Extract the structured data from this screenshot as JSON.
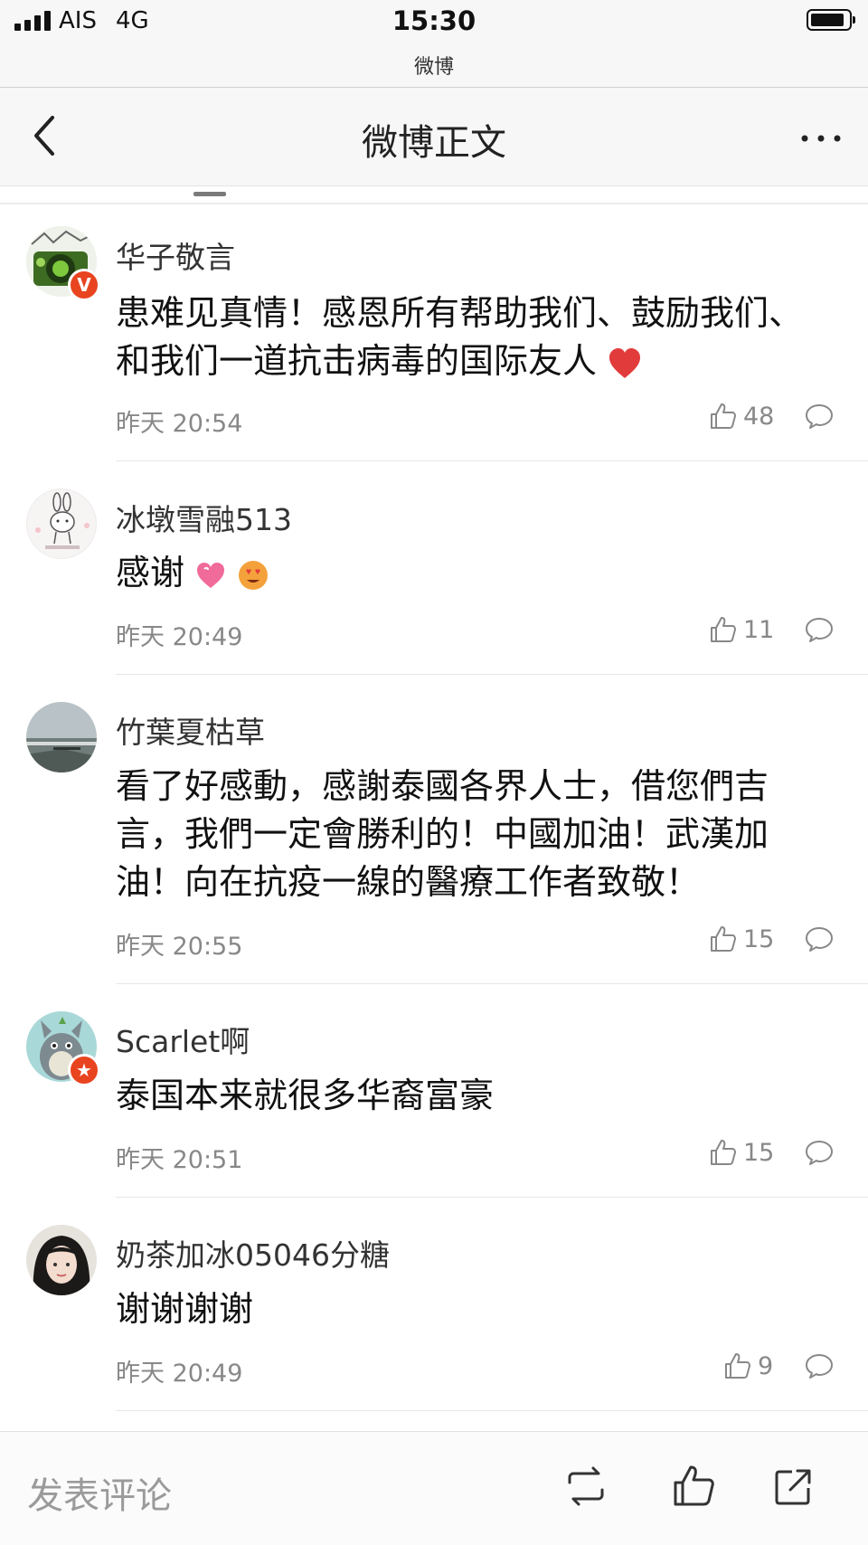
{
  "status_bar": {
    "carrier": "AIS",
    "network": "4G",
    "time": "15:30",
    "app_name": "微博"
  },
  "nav": {
    "title": "微博正文",
    "back_icon": "chevron-left-icon",
    "more_icon": "more-dots-icon"
  },
  "comments": [
    {
      "user": "华子敬言",
      "text": "患难见真情！感恩所有帮助我们、鼓励我们、和我们一道抗击病毒的国际友人",
      "emoji": [
        "heart"
      ],
      "time": "昨天 20:54",
      "likes": "48",
      "verified": true
    },
    {
      "user": "冰墩雪融513",
      "text": "感谢",
      "emoji": [
        "heart-gift",
        "heart-eyes"
      ],
      "time": "昨天 20:49",
      "likes": "11",
      "verified": false
    },
    {
      "user": "竹葉夏枯草",
      "text": "看了好感動，感謝泰國各界人士，借您們吉言，我們一定會勝利的！中國加油！武漢加油！向在抗疫一線的醫療工作者致敬！",
      "emoji": [],
      "time": "昨天 20:55",
      "likes": "15",
      "verified": false
    },
    {
      "user": "Scarlet啊",
      "text": "泰国本来就很多华裔富豪",
      "emoji": [],
      "time": "昨天 20:51",
      "likes": "15",
      "verified": true
    },
    {
      "user": "奶茶加冰05046分糖",
      "text": "谢谢谢谢",
      "emoji": [],
      "time": "昨天 20:49",
      "likes": "9",
      "verified": false
    }
  ],
  "bottom_bar": {
    "placeholder": "发表评论",
    "icons": [
      "repost-icon",
      "like-icon",
      "share-icon"
    ]
  },
  "colors": {
    "background": "#ffffff",
    "bar": "#f7f7f7",
    "text": "#111111",
    "meta": "#888888",
    "badge": "#e8441f",
    "heart": "#e23b3b"
  }
}
